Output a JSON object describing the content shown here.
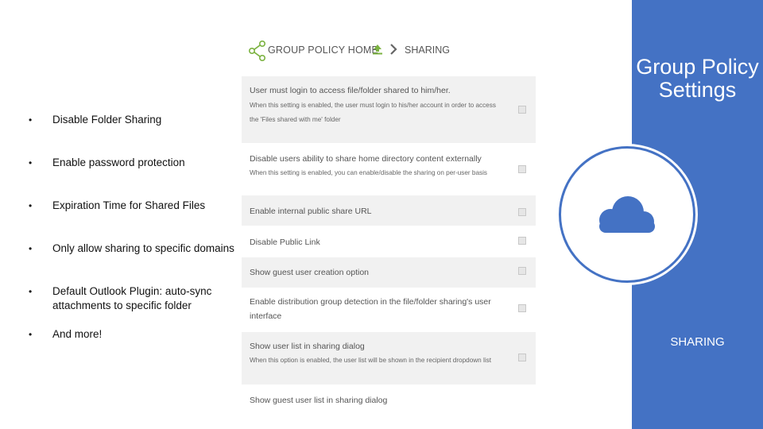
{
  "bullets": [
    {
      "text": "Disable Folder Sharing"
    },
    {
      "text": "Enable password protection"
    },
    {
      "text": "Expiration Time for Shared Files"
    },
    {
      "text": "Only allow sharing to specific domains"
    },
    {
      "text": "Default Outlook Plugin: auto-sync attachments to specific folder"
    },
    {
      "text": "And more!"
    }
  ],
  "bullet_char": "•",
  "breadcrumb": {
    "home": "GROUP POLICY HOME",
    "separator_icon": "chevron-right-icon",
    "current": "SHARING",
    "icons": [
      "share-icon",
      "upload-icon"
    ]
  },
  "settings": [
    {
      "title": "User must login to access file/folder shared to him/her.",
      "desc1": "When this setting is enabled, the user must login to his/her account in order to access",
      "desc2": "the 'Files shared with me' folder"
    },
    {
      "title": "Disable users ability to share home directory content externally",
      "desc1": "When this setting is enabled, you can enable/disable the sharing on per-user basis"
    },
    {
      "title": "Enable internal public share URL"
    },
    {
      "title": "Disable Public Link"
    },
    {
      "title": "Show guest user creation option"
    },
    {
      "title": "Enable distribution group detection in the file/folder sharing's user",
      "title2": "interface"
    },
    {
      "title": "Show user list in sharing dialog",
      "desc1": "When this option is enabled, the user list will be shown in the recipient dropdown list"
    },
    {
      "title": "Show guest user list in sharing dialog"
    }
  ],
  "right_panel": {
    "heading_line1": "Group Policy",
    "heading_line2": "Settings",
    "label": "SHARING",
    "icon": "cloud-icon",
    "color": "#4472c4"
  },
  "colors": {
    "accent_green": "#7cb342"
  }
}
